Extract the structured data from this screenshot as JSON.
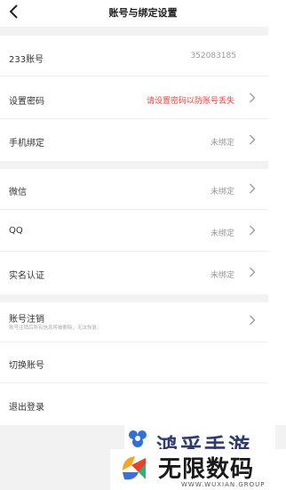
{
  "header": {
    "title": "账号与绑定设置"
  },
  "account": {
    "label": "233账号",
    "value": "352083185"
  },
  "password": {
    "label": "设置密码",
    "hint": "请设置密码以防账号丢失"
  },
  "phone": {
    "label": "手机绑定",
    "status": "未绑定"
  },
  "wechat": {
    "label": "微信",
    "status": "未绑定"
  },
  "qq": {
    "label": "QQ",
    "status": "未绑定"
  },
  "realname": {
    "label": "实名认证",
    "status": "未绑定"
  },
  "cancel": {
    "label": "账号注销",
    "sub": "账号注销后所有信息将被删除，无法恢复。"
  },
  "switch": {
    "label": "切换账号"
  },
  "logout": {
    "label": "退出登录"
  },
  "watermark": {
    "top_text": "鸿采手游",
    "name": "无限数码",
    "url": "WWW.WUXIAN.GROUP"
  },
  "colors": {
    "hint_red": "#e0463c",
    "gray_text": "#999999",
    "divider": "#f2f2f2"
  }
}
